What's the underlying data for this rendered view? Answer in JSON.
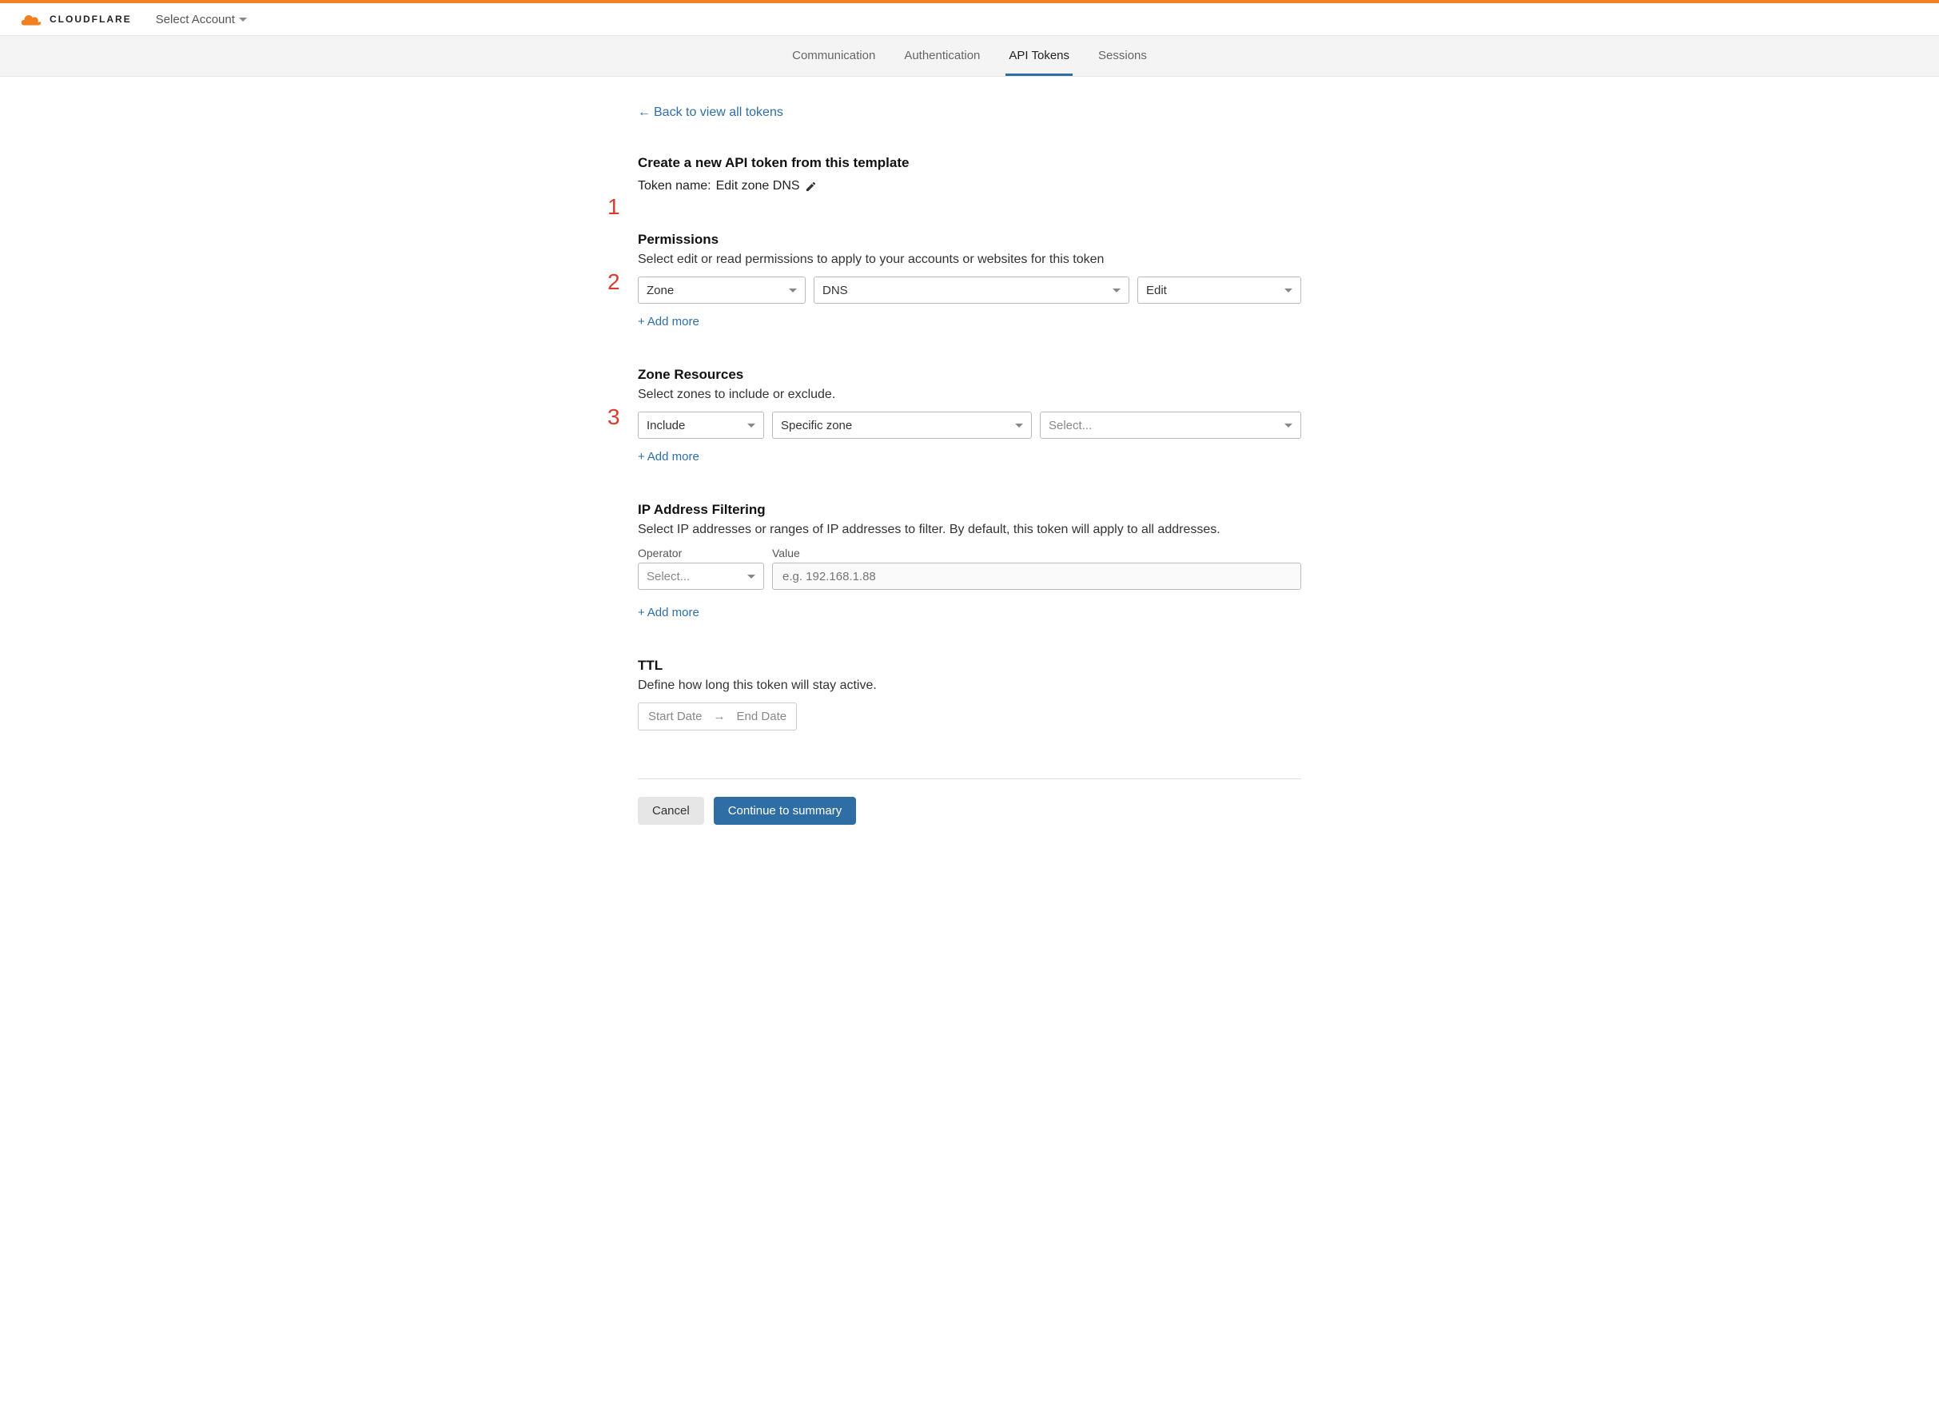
{
  "header": {
    "brand": "CLOUDFLARE",
    "account_selector": "Select Account"
  },
  "tabs": {
    "communication": "Communication",
    "authentication": "Authentication",
    "api_tokens": "API Tokens",
    "sessions": "Sessions"
  },
  "back_link": "Back to view all tokens",
  "page": {
    "title": "Create a new API token from this template",
    "token_name_label": "Token name:",
    "token_name_value": "Edit zone DNS"
  },
  "annotations": {
    "one": "1",
    "two": "2",
    "three": "3"
  },
  "permissions": {
    "title": "Permissions",
    "desc": "Select edit or read permissions to apply to your accounts or websites for this token",
    "scope": "Zone",
    "resource": "DNS",
    "level": "Edit",
    "add_more": "Add more"
  },
  "zone_resources": {
    "title": "Zone Resources",
    "desc": "Select zones to include or exclude.",
    "inclusion": "Include",
    "scope": "Specific zone",
    "zone_placeholder": "Select...",
    "add_more": "Add more"
  },
  "ip_filtering": {
    "title": "IP Address Filtering",
    "desc": "Select IP addresses or ranges of IP addresses to filter. By default, this token will apply to all addresses.",
    "operator_label": "Operator",
    "value_label": "Value",
    "operator_placeholder": "Select...",
    "value_placeholder": "e.g. 192.168.1.88",
    "add_more": "Add more"
  },
  "ttl": {
    "title": "TTL",
    "desc": "Define how long this token will stay active.",
    "start_placeholder": "Start Date",
    "end_placeholder": "End Date"
  },
  "footer": {
    "cancel": "Cancel",
    "continue": "Continue to summary"
  }
}
